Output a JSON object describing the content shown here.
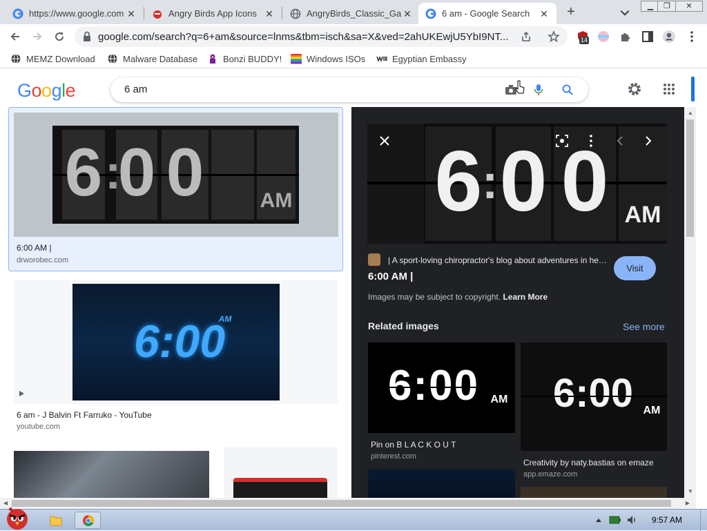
{
  "browser": {
    "tabs": [
      {
        "title": "https://www.google.com",
        "favicon": "google-icon"
      },
      {
        "title": "Angry Birds App Icons",
        "favicon": "angry-bird-icon"
      },
      {
        "title": "AngryBirds_Classic_Gam",
        "favicon": "globe-icon"
      },
      {
        "title": "6 am - Google Search",
        "favicon": "google-icon",
        "active": true
      }
    ],
    "address": "google.com/search?q=6+am&source=lnms&tbm=isch&sa=X&ved=2ahUKEwjU5YbI9NT...",
    "extension_badge": "14",
    "bookmarks": [
      {
        "label": "MEMZ Download",
        "icon": "globe-icon"
      },
      {
        "label": "Malware Database",
        "icon": "globe-icon"
      },
      {
        "label": "Bonzi BUDDY!",
        "icon": "bonzi-icon"
      },
      {
        "label": "Windows ISOs",
        "icon": "rainbow-flag-icon"
      },
      {
        "label": "Egyptian Embassy",
        "icon": "wix-icon"
      }
    ]
  },
  "google": {
    "query": "6 am"
  },
  "results": [
    {
      "title": "6:00 AM |",
      "source": "drworobec.com"
    },
    {
      "title": "6 am - J Balvin Ft Farruko - YouTube",
      "source": "youtube.com"
    }
  ],
  "preview": {
    "site": "| A sport-loving chiropractor's blog about adventures in healt...",
    "title": "6:00 AM |",
    "visit": "Visit",
    "copyright": "Images may be subject to copyright.",
    "learn_more": "Learn More",
    "related_heading": "Related images",
    "see_more": "See more",
    "related": [
      {
        "title": "Pin on B L A C K O U T",
        "source": "pinterest.com"
      },
      {
        "title": "Creativity by naty.bastias on emaze",
        "source": "app.emaze.com"
      }
    ]
  },
  "taskbar": {
    "clock": "9:57 AM"
  },
  "colors": {
    "accent": "#1a73e8",
    "visit_button": "#8ab4f8",
    "panel_bg": "#202124"
  }
}
